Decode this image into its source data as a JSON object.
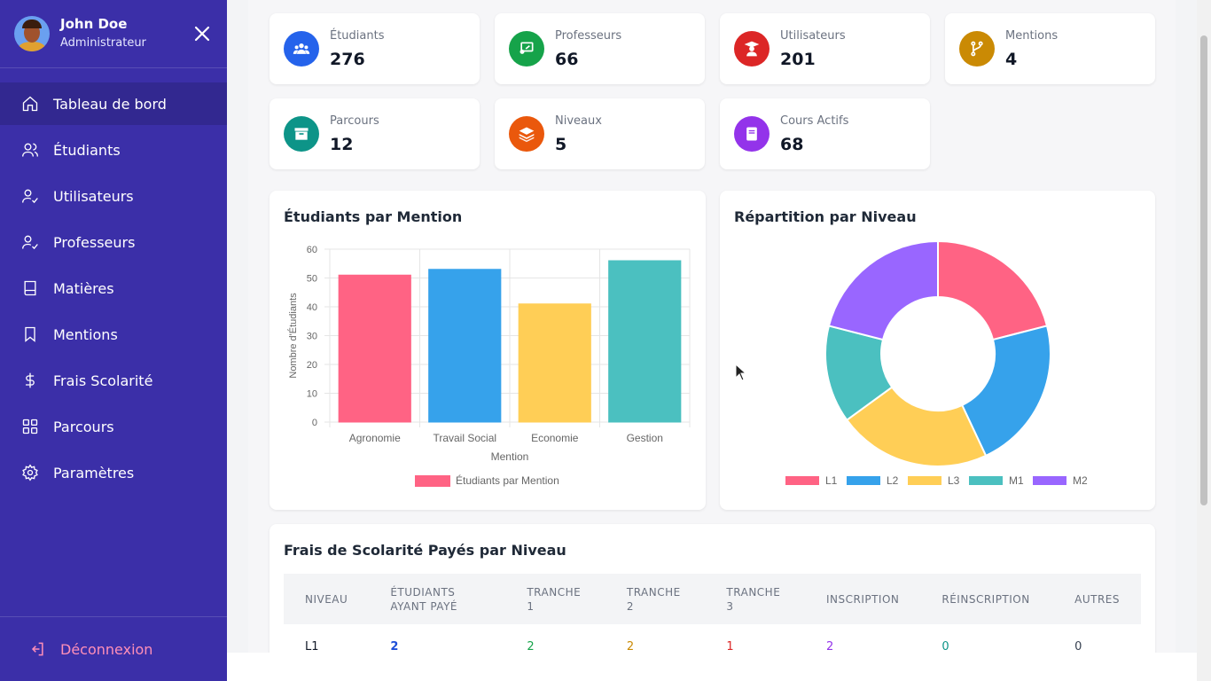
{
  "user": {
    "name": "John Doe",
    "role": "Administrateur"
  },
  "nav": [
    {
      "label": "Tableau de bord",
      "icon": "home-icon",
      "active": true
    },
    {
      "label": "Étudiants",
      "icon": "users-icon"
    },
    {
      "label": "Utilisateurs",
      "icon": "user-check-icon"
    },
    {
      "label": "Professeurs",
      "icon": "user-check-icon"
    },
    {
      "label": "Matières",
      "icon": "book-icon"
    },
    {
      "label": "Mentions",
      "icon": "bookmark-icon"
    },
    {
      "label": "Frais Scolarité",
      "icon": "dollar-icon"
    },
    {
      "label": "Parcours",
      "icon": "grid-icon"
    },
    {
      "label": "Paramètres",
      "icon": "gear-icon"
    }
  ],
  "logout": "Déconnexion",
  "stats": [
    {
      "label": "Étudiants",
      "value": "276",
      "color": "#2563eb",
      "icon": "users-icon"
    },
    {
      "label": "Professeurs",
      "value": "66",
      "color": "#16a34a",
      "icon": "presentation-icon"
    },
    {
      "label": "Utilisateurs",
      "value": "201",
      "color": "#dc2626",
      "icon": "graduate-icon"
    },
    {
      "label": "Mentions",
      "value": "4",
      "color": "#ca8a04",
      "icon": "branch-icon"
    },
    {
      "label": "Parcours",
      "value": "12",
      "color": "#0d9488",
      "icon": "archive-icon"
    },
    {
      "label": "Niveaux",
      "value": "5",
      "color": "#ea580c",
      "icon": "layers-icon"
    },
    {
      "label": "Cours Actifs",
      "value": "68",
      "color": "#9333ea",
      "icon": "book-icon"
    }
  ],
  "bar_panel": {
    "title": "Étudiants par Mention"
  },
  "donut_panel": {
    "title": "Répartition par Niveau"
  },
  "chart_data": [
    {
      "type": "bar",
      "categories": [
        "Agronomie",
        "Travail Social",
        "Economie",
        "Gestion"
      ],
      "values": [
        51,
        53,
        41,
        56
      ],
      "colors": [
        "#ff6384",
        "#36a2eb",
        "#ffce56",
        "#4bc0c0"
      ],
      "xlabel": "Mention",
      "ylabel": "Nombre d'Étudiants",
      "ylim": [
        0,
        60
      ],
      "yticks": [
        "0",
        "10",
        "20",
        "30",
        "40",
        "50",
        "60"
      ],
      "legend": "Étudiants par Mention",
      "grid": true
    },
    {
      "type": "pie",
      "categories": [
        "L1",
        "L2",
        "L3",
        "M1",
        "M2"
      ],
      "values": [
        21,
        22,
        22,
        14,
        21
      ],
      "colors": [
        "#ff6384",
        "#36a2eb",
        "#ffce56",
        "#4bc0c0",
        "#9966ff"
      ],
      "legend_position": "bottom"
    }
  ],
  "fees": {
    "title": "Frais de Scolarité Payés par Niveau",
    "headers": [
      "NIVEAU",
      "ÉTUDIANTS AYANT PAYÉ",
      "TRANCHE 1",
      "TRANCHE 2",
      "TRANCHE 3",
      "INSCRIPTION",
      "RÉINSCRIPTION",
      "AUTRES"
    ],
    "rows": [
      [
        "L1",
        "2",
        "2",
        "2",
        "1",
        "2",
        "0",
        "0"
      ]
    ],
    "cell_colors": [
      "#111827",
      "#1d4ed8",
      "#16a34a",
      "#ca8a04",
      "#dc2626",
      "#9333ea",
      "#0d9488",
      "#374151"
    ]
  }
}
